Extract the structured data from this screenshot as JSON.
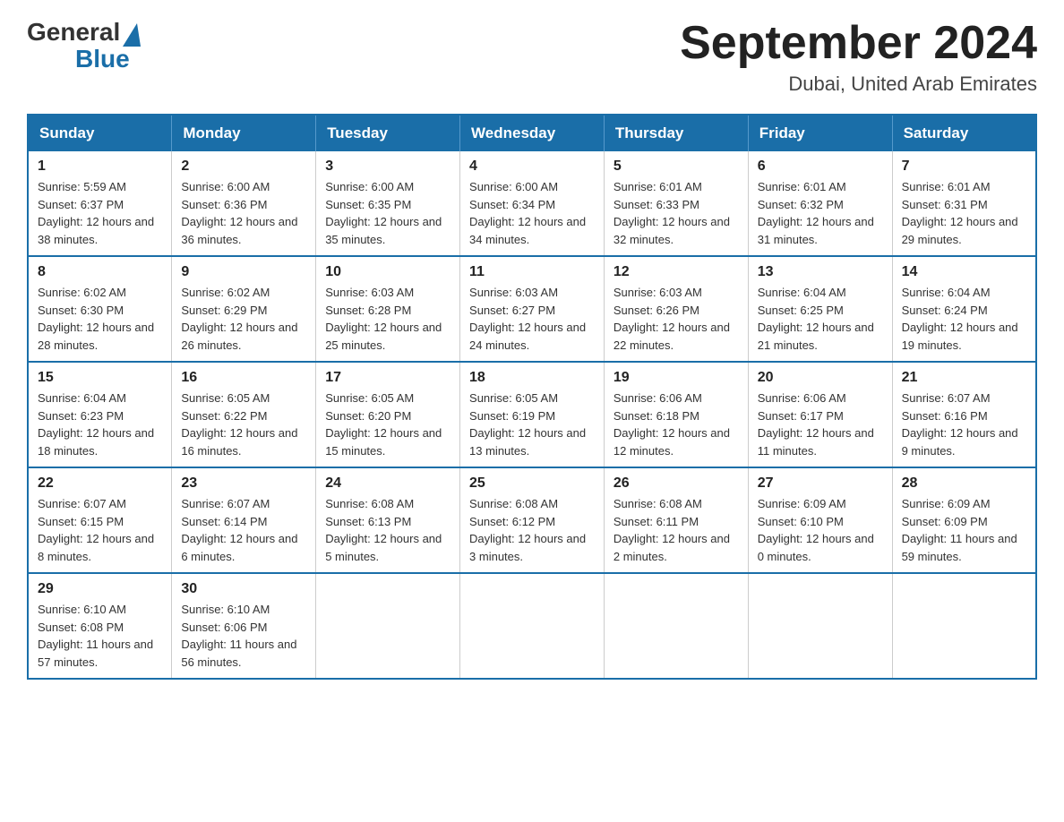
{
  "header": {
    "logo_general": "General",
    "logo_blue": "Blue",
    "title": "September 2024",
    "subtitle": "Dubai, United Arab Emirates"
  },
  "weekdays": [
    "Sunday",
    "Monday",
    "Tuesday",
    "Wednesday",
    "Thursday",
    "Friday",
    "Saturday"
  ],
  "weeks": [
    [
      {
        "day": "1",
        "sunrise": "5:59 AM",
        "sunset": "6:37 PM",
        "daylight": "12 hours and 38 minutes."
      },
      {
        "day": "2",
        "sunrise": "6:00 AM",
        "sunset": "6:36 PM",
        "daylight": "12 hours and 36 minutes."
      },
      {
        "day": "3",
        "sunrise": "6:00 AM",
        "sunset": "6:35 PM",
        "daylight": "12 hours and 35 minutes."
      },
      {
        "day": "4",
        "sunrise": "6:00 AM",
        "sunset": "6:34 PM",
        "daylight": "12 hours and 34 minutes."
      },
      {
        "day": "5",
        "sunrise": "6:01 AM",
        "sunset": "6:33 PM",
        "daylight": "12 hours and 32 minutes."
      },
      {
        "day": "6",
        "sunrise": "6:01 AM",
        "sunset": "6:32 PM",
        "daylight": "12 hours and 31 minutes."
      },
      {
        "day": "7",
        "sunrise": "6:01 AM",
        "sunset": "6:31 PM",
        "daylight": "12 hours and 29 minutes."
      }
    ],
    [
      {
        "day": "8",
        "sunrise": "6:02 AM",
        "sunset": "6:30 PM",
        "daylight": "12 hours and 28 minutes."
      },
      {
        "day": "9",
        "sunrise": "6:02 AM",
        "sunset": "6:29 PM",
        "daylight": "12 hours and 26 minutes."
      },
      {
        "day": "10",
        "sunrise": "6:03 AM",
        "sunset": "6:28 PM",
        "daylight": "12 hours and 25 minutes."
      },
      {
        "day": "11",
        "sunrise": "6:03 AM",
        "sunset": "6:27 PM",
        "daylight": "12 hours and 24 minutes."
      },
      {
        "day": "12",
        "sunrise": "6:03 AM",
        "sunset": "6:26 PM",
        "daylight": "12 hours and 22 minutes."
      },
      {
        "day": "13",
        "sunrise": "6:04 AM",
        "sunset": "6:25 PM",
        "daylight": "12 hours and 21 minutes."
      },
      {
        "day": "14",
        "sunrise": "6:04 AM",
        "sunset": "6:24 PM",
        "daylight": "12 hours and 19 minutes."
      }
    ],
    [
      {
        "day": "15",
        "sunrise": "6:04 AM",
        "sunset": "6:23 PM",
        "daylight": "12 hours and 18 minutes."
      },
      {
        "day": "16",
        "sunrise": "6:05 AM",
        "sunset": "6:22 PM",
        "daylight": "12 hours and 16 minutes."
      },
      {
        "day": "17",
        "sunrise": "6:05 AM",
        "sunset": "6:20 PM",
        "daylight": "12 hours and 15 minutes."
      },
      {
        "day": "18",
        "sunrise": "6:05 AM",
        "sunset": "6:19 PM",
        "daylight": "12 hours and 13 minutes."
      },
      {
        "day": "19",
        "sunrise": "6:06 AM",
        "sunset": "6:18 PM",
        "daylight": "12 hours and 12 minutes."
      },
      {
        "day": "20",
        "sunrise": "6:06 AM",
        "sunset": "6:17 PM",
        "daylight": "12 hours and 11 minutes."
      },
      {
        "day": "21",
        "sunrise": "6:07 AM",
        "sunset": "6:16 PM",
        "daylight": "12 hours and 9 minutes."
      }
    ],
    [
      {
        "day": "22",
        "sunrise": "6:07 AM",
        "sunset": "6:15 PM",
        "daylight": "12 hours and 8 minutes."
      },
      {
        "day": "23",
        "sunrise": "6:07 AM",
        "sunset": "6:14 PM",
        "daylight": "12 hours and 6 minutes."
      },
      {
        "day": "24",
        "sunrise": "6:08 AM",
        "sunset": "6:13 PM",
        "daylight": "12 hours and 5 minutes."
      },
      {
        "day": "25",
        "sunrise": "6:08 AM",
        "sunset": "6:12 PM",
        "daylight": "12 hours and 3 minutes."
      },
      {
        "day": "26",
        "sunrise": "6:08 AM",
        "sunset": "6:11 PM",
        "daylight": "12 hours and 2 minutes."
      },
      {
        "day": "27",
        "sunrise": "6:09 AM",
        "sunset": "6:10 PM",
        "daylight": "12 hours and 0 minutes."
      },
      {
        "day": "28",
        "sunrise": "6:09 AM",
        "sunset": "6:09 PM",
        "daylight": "11 hours and 59 minutes."
      }
    ],
    [
      {
        "day": "29",
        "sunrise": "6:10 AM",
        "sunset": "6:08 PM",
        "daylight": "11 hours and 57 minutes."
      },
      {
        "day": "30",
        "sunrise": "6:10 AM",
        "sunset": "6:06 PM",
        "daylight": "11 hours and 56 minutes."
      },
      null,
      null,
      null,
      null,
      null
    ]
  ]
}
